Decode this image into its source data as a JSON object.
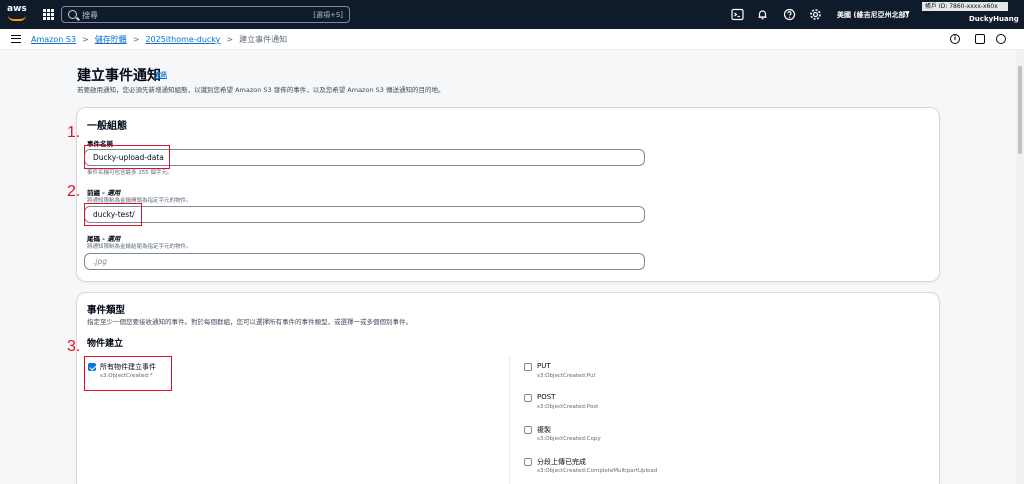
{
  "topnav": {
    "logo_text": "aws",
    "search_placeholder": "搜尋",
    "search_shortcut": "[選項+S]",
    "region": "美國 (維吉尼亞州北部)",
    "account_text": "帳戶 ID: 7860-xxxx-x60x",
    "username": "DuckyHuang"
  },
  "breadcrumb": {
    "items": [
      "Amazon S3",
      "儲存貯體",
      "2025ithome-ducky"
    ],
    "current": "建立事件通知"
  },
  "page": {
    "title": "建立事件通知",
    "info": "資訊",
    "description": "若要啟用通知，您必須先新增通知組態，以識別您希望 Amazon S3 發佈的事件，以及您希望 Amazon S3 傳送通知的目的地。"
  },
  "general": {
    "title": "一般組態",
    "event_name_label": "事件名稱",
    "event_name_value": "Ducky-upload-data",
    "event_name_hint": "事件名稱可包含最多 255 個字元。",
    "prefix_label": "前綴",
    "prefix_optional": "- 選用",
    "prefix_hint": "將通知限制為金鑰開頭為指定字元的物件。",
    "prefix_value": "ducky-test/",
    "suffix_label": "尾碼",
    "suffix_optional": "- 選用",
    "suffix_hint": "將通知限制為金鑰結尾為指定字元的物件。",
    "suffix_placeholder": ".jpg"
  },
  "event_types": {
    "title": "事件類型",
    "description": "指定至少一個您要接收通知的事件。對於每個群組，您可以選擇所有事件的事件類型，或選擇一或多個個別事件。",
    "object_creation_title": "物件建立",
    "all_objects": {
      "label": "所有物件建立事件",
      "sub": "s3:ObjectCreated:*"
    },
    "options": [
      {
        "label": "PUT",
        "sub": "s3:ObjectCreated:Put"
      },
      {
        "label": "POST",
        "sub": "s3:ObjectCreated:Post"
      },
      {
        "label": "複製",
        "sub": "s3:ObjectCreated:Copy"
      },
      {
        "label": "分段上傳已完成",
        "sub": "s3:ObjectCreated:CompleteMultipartUpload"
      }
    ]
  },
  "annotations": [
    "1.",
    "2.",
    "3."
  ],
  "colors": {
    "nav_bg": "#0f1b2a",
    "link": "#0972d3",
    "annotation": "#e0112b",
    "page_bg": "#f6f7f8"
  }
}
